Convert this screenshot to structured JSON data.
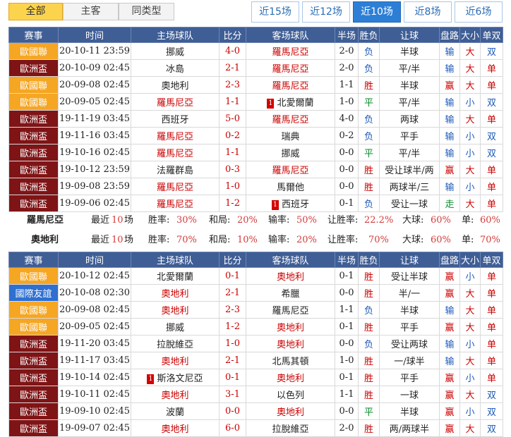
{
  "filter_tabs": [
    "全部",
    "主客",
    "同类型"
  ],
  "count_tabs": [
    "近15场",
    "近12场",
    "近10场",
    "近8场",
    "近6场"
  ],
  "headers": [
    "赛事",
    "时间",
    "主场球队",
    "比分",
    "客场球队",
    "半场",
    "胜负",
    "让球",
    "盘路",
    "大小",
    "单双"
  ],
  "colors": {
    "euro_nations": "#f5a623",
    "euro_cup": "#7f1416",
    "friendly": "#2e6fd0",
    "header": "#3f5e96",
    "accent_tab": "#2d7fd6"
  },
  "table1": [
    {
      "league": "歐國聯",
      "lt": "n",
      "time": "20-10-11 23:59",
      "home": "挪威",
      "hc": "",
      "score": "4-0",
      "away": "羅馬尼亞",
      "ac": "red",
      "ht": "2-0",
      "res": "负",
      "rc": "blue",
      "hcp": "半球",
      "pan": "输",
      "pc": "blue",
      "ou": "大",
      "oc": "red",
      "oe": "双",
      "ec": "blue"
    },
    {
      "league": "歐洲盃",
      "lt": "e",
      "time": "20-10-09 02:45",
      "home": "冰島",
      "hc": "",
      "score": "2-1",
      "away": "羅馬尼亞",
      "ac": "red",
      "ht": "2-0",
      "res": "负",
      "rc": "blue",
      "hcp": "平/半",
      "pan": "输",
      "pc": "blue",
      "ou": "大",
      "oc": "red",
      "oe": "单",
      "ec": "red"
    },
    {
      "league": "歐國聯",
      "lt": "n",
      "time": "20-09-08 02:45",
      "home": "奧地利",
      "hc": "",
      "score": "2-3",
      "away": "羅馬尼亞",
      "ac": "red",
      "ht": "1-1",
      "res": "胜",
      "rc": "red",
      "hcp": "半球",
      "pan": "赢",
      "pc": "red",
      "ou": "大",
      "oc": "red",
      "oe": "单",
      "ec": "red"
    },
    {
      "league": "歐國聯",
      "lt": "n",
      "time": "20-09-05 02:45",
      "home": "羅馬尼亞",
      "hc": "red",
      "score": "1-1",
      "away": "北愛爾蘭",
      "ac": "",
      "am": "1",
      "ht": "1-0",
      "res": "平",
      "rc": "green",
      "hcp": "平/半",
      "pan": "输",
      "pc": "blue",
      "ou": "小",
      "oc": "blue",
      "oe": "双",
      "ec": "blue"
    },
    {
      "league": "歐洲盃",
      "lt": "e",
      "time": "19-11-19 03:45",
      "home": "西班牙",
      "hc": "",
      "score": "5-0",
      "away": "羅馬尼亞",
      "ac": "red",
      "ht": "4-0",
      "res": "负",
      "rc": "blue",
      "hcp": "两球",
      "pan": "输",
      "pc": "blue",
      "ou": "大",
      "oc": "red",
      "oe": "单",
      "ec": "red"
    },
    {
      "league": "歐洲盃",
      "lt": "e",
      "time": "19-11-16 03:45",
      "home": "羅馬尼亞",
      "hc": "red",
      "score": "0-2",
      "away": "瑞典",
      "ac": "",
      "ht": "0-2",
      "res": "负",
      "rc": "blue",
      "hcp": "平手",
      "pan": "输",
      "pc": "blue",
      "ou": "小",
      "oc": "blue",
      "oe": "双",
      "ec": "blue"
    },
    {
      "league": "歐洲盃",
      "lt": "e",
      "time": "19-10-16 02:45",
      "home": "羅馬尼亞",
      "hc": "red",
      "score": "1-1",
      "away": "挪威",
      "ac": "",
      "ht": "0-0",
      "res": "平",
      "rc": "green",
      "hcp": "平/半",
      "pan": "输",
      "pc": "blue",
      "ou": "小",
      "oc": "blue",
      "oe": "双",
      "ec": "blue"
    },
    {
      "league": "歐洲盃",
      "lt": "e",
      "time": "19-10-12 23:59",
      "home": "法羅群島",
      "hc": "",
      "score": "0-3",
      "away": "羅馬尼亞",
      "ac": "red",
      "ht": "0-0",
      "res": "胜",
      "rc": "red",
      "hcp": "受让球半/两",
      "pan": "赢",
      "pc": "red",
      "ou": "大",
      "oc": "red",
      "oe": "单",
      "ec": "red"
    },
    {
      "league": "歐洲盃",
      "lt": "e",
      "time": "19-09-08 23:59",
      "home": "羅馬尼亞",
      "hc": "red",
      "score": "1-0",
      "away": "馬爾他",
      "ac": "",
      "ht": "0-0",
      "res": "胜",
      "rc": "red",
      "hcp": "两球半/三",
      "pan": "输",
      "pc": "blue",
      "ou": "小",
      "oc": "blue",
      "oe": "单",
      "ec": "red"
    },
    {
      "league": "歐洲盃",
      "lt": "e",
      "time": "19-09-06 02:45",
      "home": "羅馬尼亞",
      "hc": "red",
      "score": "1-2",
      "away": "西班牙",
      "ac": "",
      "am": "1",
      "ht": "0-1",
      "res": "负",
      "rc": "blue",
      "hcp": "受让一球",
      "pan": "走",
      "pc": "green",
      "ou": "大",
      "oc": "red",
      "oe": "单",
      "ec": "red"
    }
  ],
  "summary1": {
    "team": "羅馬尼亞",
    "recent": "最近",
    "n": "10",
    "unit": "场",
    "win_label": "胜率:",
    "win": "30%",
    "draw_label": "和局:",
    "draw": "20%",
    "loss_label": "输率:",
    "loss": "50%",
    "hcp_label": "让胜率:",
    "hcp": "22.2%",
    "big_label": "大球:",
    "big": "60%",
    "odd_label": "单:",
    "odd": "60%"
  },
  "summary2": {
    "team": "奧地利",
    "recent": "最近",
    "n": "10",
    "unit": "场",
    "win_label": "胜率:",
    "win": "70%",
    "draw_label": "和局:",
    "draw": "10%",
    "loss_label": "输率:",
    "loss": "20%",
    "hcp_label": "让胜率:",
    "hcp": "70%",
    "big_label": "大球:",
    "big": "60%",
    "odd_label": "单:",
    "odd": "70%"
  },
  "table2": [
    {
      "league": "歐國聯",
      "lt": "n",
      "time": "20-10-12 02:45",
      "home": "北愛爾蘭",
      "hc": "",
      "score": "0-1",
      "away": "奧地利",
      "ac": "red",
      "ht": "0-1",
      "res": "胜",
      "rc": "red",
      "hcp": "受让半球",
      "pan": "赢",
      "pc": "red",
      "ou": "小",
      "oc": "blue",
      "oe": "单",
      "ec": "red"
    },
    {
      "league": "國際友誼",
      "lt": "f",
      "time": "20-10-08 02:30",
      "home": "奧地利",
      "hc": "red",
      "score": "2-1",
      "away": "希臘",
      "ac": "",
      "ht": "0-0",
      "res": "胜",
      "rc": "red",
      "hcp": "半/一",
      "pan": "赢",
      "pc": "red",
      "ou": "大",
      "oc": "red",
      "oe": "单",
      "ec": "red"
    },
    {
      "league": "歐國聯",
      "lt": "n",
      "time": "20-09-08 02:45",
      "home": "奧地利",
      "hc": "red",
      "score": "2-3",
      "away": "羅馬尼亞",
      "ac": "",
      "ht": "1-1",
      "res": "负",
      "rc": "blue",
      "hcp": "半球",
      "pan": "输",
      "pc": "blue",
      "ou": "大",
      "oc": "red",
      "oe": "单",
      "ec": "red"
    },
    {
      "league": "歐國聯",
      "lt": "n",
      "time": "20-09-05 02:45",
      "home": "挪威",
      "hc": "",
      "score": "1-2",
      "away": "奧地利",
      "ac": "red",
      "ht": "0-1",
      "res": "胜",
      "rc": "red",
      "hcp": "平手",
      "pan": "赢",
      "pc": "red",
      "ou": "大",
      "oc": "red",
      "oe": "单",
      "ec": "red"
    },
    {
      "league": "歐洲盃",
      "lt": "e",
      "time": "19-11-20 03:45",
      "home": "拉脫維亞",
      "hc": "",
      "score": "1-0",
      "away": "奧地利",
      "ac": "red",
      "ht": "0-0",
      "res": "负",
      "rc": "blue",
      "hcp": "受让两球",
      "pan": "输",
      "pc": "blue",
      "ou": "小",
      "oc": "blue",
      "oe": "单",
      "ec": "red"
    },
    {
      "league": "歐洲盃",
      "lt": "e",
      "time": "19-11-17 03:45",
      "home": "奧地利",
      "hc": "red",
      "score": "2-1",
      "away": "北馬其頓",
      "ac": "",
      "ht": "1-0",
      "res": "胜",
      "rc": "red",
      "hcp": "一/球半",
      "pan": "输",
      "pc": "blue",
      "ou": "大",
      "oc": "red",
      "oe": "单",
      "ec": "red"
    },
    {
      "league": "歐洲盃",
      "lt": "e",
      "time": "19-10-14 02:45",
      "home": "斯洛文尼亞",
      "hc": "",
      "hm": "1",
      "score": "0-1",
      "away": "奧地利",
      "ac": "red",
      "ht": "0-1",
      "res": "胜",
      "rc": "red",
      "hcp": "平手",
      "pan": "赢",
      "pc": "red",
      "ou": "小",
      "oc": "blue",
      "oe": "单",
      "ec": "red"
    },
    {
      "league": "歐洲盃",
      "lt": "e",
      "time": "19-10-11 02:45",
      "home": "奧地利",
      "hc": "red",
      "score": "3-1",
      "away": "以色列",
      "ac": "",
      "ht": "1-1",
      "res": "胜",
      "rc": "red",
      "hcp": "一球",
      "pan": "赢",
      "pc": "red",
      "ou": "大",
      "oc": "red",
      "oe": "双",
      "ec": "blue"
    },
    {
      "league": "歐洲盃",
      "lt": "e",
      "time": "19-09-10 02:45",
      "home": "波蘭",
      "hc": "",
      "score": "0-0",
      "away": "奧地利",
      "ac": "red",
      "ht": "0-0",
      "res": "平",
      "rc": "green",
      "hcp": "半球",
      "pan": "赢",
      "pc": "red",
      "ou": "小",
      "oc": "blue",
      "oe": "双",
      "ec": "blue"
    },
    {
      "league": "歐洲盃",
      "lt": "e",
      "time": "19-09-07 02:45",
      "home": "奧地利",
      "hc": "red",
      "score": "6-0",
      "away": "拉脫維亞",
      "ac": "",
      "ht": "2-0",
      "res": "胜",
      "rc": "red",
      "hcp": "两/两球半",
      "pan": "赢",
      "pc": "red",
      "ou": "大",
      "oc": "red",
      "oe": "双",
      "ec": "blue"
    }
  ]
}
